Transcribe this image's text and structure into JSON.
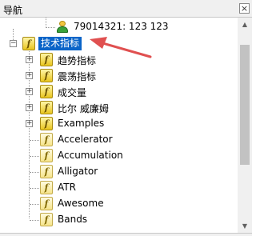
{
  "panel": {
    "title": "导航",
    "close_glyph": "×"
  },
  "tree": {
    "account": {
      "label": "79014321: 123 123",
      "icon": "user-icon"
    },
    "root": {
      "label": "技术指标",
      "expander": "−",
      "selected": true
    },
    "folders": [
      {
        "label": "趋势指标",
        "expander": "+"
      },
      {
        "label": "震荡指标",
        "expander": "+"
      },
      {
        "label": "成交量",
        "expander": "+"
      },
      {
        "label": "比尔 威廉姆",
        "expander": "+"
      },
      {
        "label": "Examples",
        "expander": "+"
      }
    ],
    "indicators": [
      {
        "label": "Accelerator"
      },
      {
        "label": "Accumulation"
      },
      {
        "label": "Alligator"
      },
      {
        "label": "ATR"
      },
      {
        "label": "Awesome"
      },
      {
        "label": "Bands"
      }
    ]
  },
  "scrollbar": {
    "up_glyph": "▲",
    "down_glyph": "▼"
  },
  "annotation": {
    "color": "#e05050"
  }
}
